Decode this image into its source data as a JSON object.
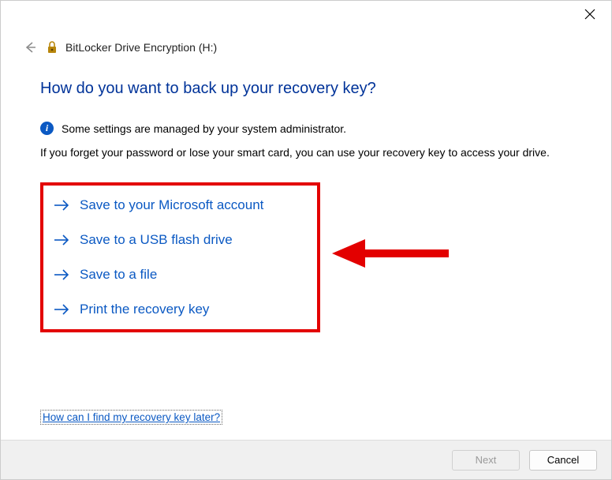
{
  "titlebar": {
    "close_icon": "close"
  },
  "header": {
    "back_icon": "back",
    "title": "BitLocker Drive Encryption (H:)"
  },
  "main": {
    "heading": "How do you want to back up your recovery key?",
    "info_text": "Some settings are managed by your system administrator.",
    "description": "If you forget your password or lose your smart card, you can use your recovery key to access your drive."
  },
  "options": [
    {
      "label": "Save to your Microsoft account"
    },
    {
      "label": "Save to a USB flash drive"
    },
    {
      "label": "Save to a file"
    },
    {
      "label": "Print the recovery key"
    }
  ],
  "help_link": "How can I find my recovery key later?",
  "footer": {
    "next": "Next",
    "cancel": "Cancel"
  },
  "colors": {
    "link_blue": "#0b59c3",
    "heading_blue": "#003399",
    "annotation_red": "#e30000"
  }
}
